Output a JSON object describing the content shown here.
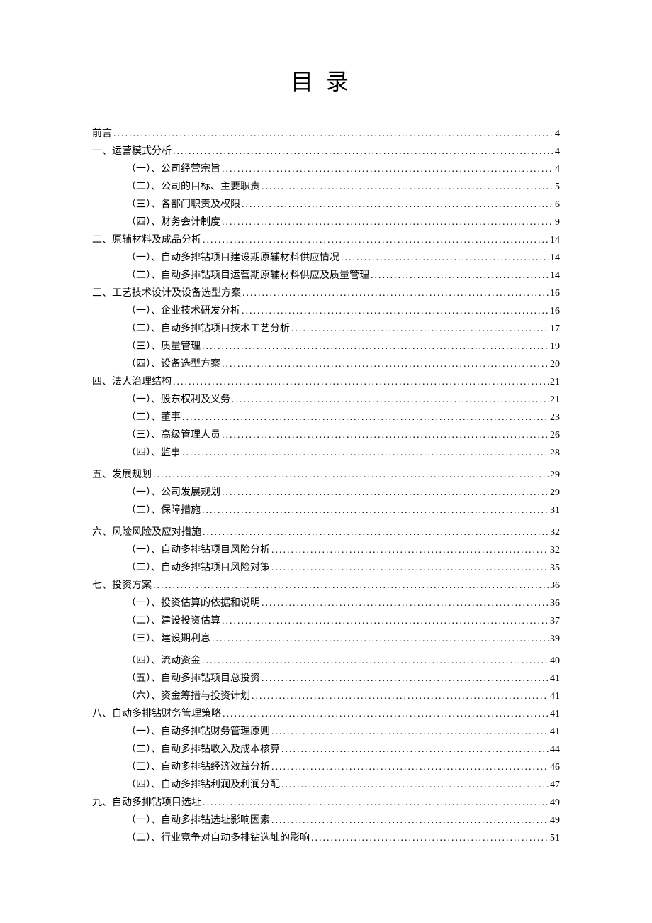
{
  "title": "目录",
  "entries": [
    {
      "level": 0,
      "text": "前言",
      "page": "4"
    },
    {
      "level": 0,
      "text": "一、运营模式分析",
      "page": "4"
    },
    {
      "level": 1,
      "text": "（一）、公司经营宗旨",
      "page": "4"
    },
    {
      "level": 1,
      "text": "（二）、公司的目标、主要职责",
      "page": "5"
    },
    {
      "level": 1,
      "text": "（三）、各部门职责及权限",
      "page": "6"
    },
    {
      "level": 1,
      "text": "（四）、财务会计制度",
      "page": "9"
    },
    {
      "level": 0,
      "text": "二、原辅材料及成品分析",
      "page": "14"
    },
    {
      "level": 1,
      "text": "（一）、自动多排钻项目建设期原辅材料供应情况",
      "page": "14"
    },
    {
      "level": 1,
      "text": "（二）、自动多排钻项目运营期原辅材料供应及质量管理",
      "page": "14"
    },
    {
      "level": 0,
      "text": "三、工艺技术设计及设备选型方案",
      "page": "16"
    },
    {
      "level": 1,
      "text": "（一）、企业技术研发分析",
      "page": "16"
    },
    {
      "level": 1,
      "text": "（二）、自动多排钻项目技术工艺分析",
      "page": "17"
    },
    {
      "level": 1,
      "text": "（三）、质量管理",
      "page": "19"
    },
    {
      "level": 1,
      "text": "（四）、设备选型方案",
      "page": "20"
    },
    {
      "level": 0,
      "text": "四、法人治理结构",
      "page": "21"
    },
    {
      "level": 1,
      "text": "（一）、股东权利及义务",
      "page": "21"
    },
    {
      "level": 1,
      "text": "（二）、董事",
      "page": "23"
    },
    {
      "level": 1,
      "text": "（三）、高级管理人员",
      "page": "26"
    },
    {
      "level": 1,
      "text": "（四）、监事",
      "page": "28"
    },
    {
      "level": 0,
      "text": "五、发展规划",
      "page": "29",
      "gap": true
    },
    {
      "level": 1,
      "text": "（一）、公司发展规划",
      "page": "29"
    },
    {
      "level": 1,
      "text": "（二）、保障措施",
      "page": "31"
    },
    {
      "level": 0,
      "text": "六、风险风险及应对措施",
      "page": "32",
      "gap": true
    },
    {
      "level": 1,
      "text": "（一）、自动多排钻项目风险分析",
      "page": "32"
    },
    {
      "level": 1,
      "text": "（二）、自动多排钻项目风险对策",
      "page": "35"
    },
    {
      "level": 0,
      "text": "七、投资方案",
      "page": "36"
    },
    {
      "level": 1,
      "text": "（一）、投资估算的依据和说明",
      "page": "36"
    },
    {
      "level": 1,
      "text": "（二）、建设投资估算",
      "page": "37"
    },
    {
      "level": 1,
      "text": "（三）、建设期利息",
      "page": "39"
    },
    {
      "level": 1,
      "text": "（四）、流动资金",
      "page": "40",
      "gap": true
    },
    {
      "level": 1,
      "text": "（五）、自动多排钻项目总投资",
      "page": "41"
    },
    {
      "level": 1,
      "text": "（六）、资金筹措与投资计划",
      "page": "41"
    },
    {
      "level": 0,
      "text": "八、自动多排钻财务管理策略",
      "page": "41"
    },
    {
      "level": 1,
      "text": "（一）、自动多排钻财务管理原则",
      "page": "41"
    },
    {
      "level": 1,
      "text": "（二）、自动多排钻收入及成本核算",
      "page": "44"
    },
    {
      "level": 1,
      "text": "（三）、自动多排钻经济效益分析",
      "page": "46"
    },
    {
      "level": 1,
      "text": "（四）、自动多排钻利润及利润分配",
      "page": "47"
    },
    {
      "level": 0,
      "text": "九、自动多排钻项目选址",
      "page": "49"
    },
    {
      "level": 1,
      "text": "（一）、自动多排钻选址影响因素",
      "page": "49"
    },
    {
      "level": 1,
      "text": "（二）、行业竞争对自动多排钻选址的影响",
      "page": "51"
    }
  ]
}
